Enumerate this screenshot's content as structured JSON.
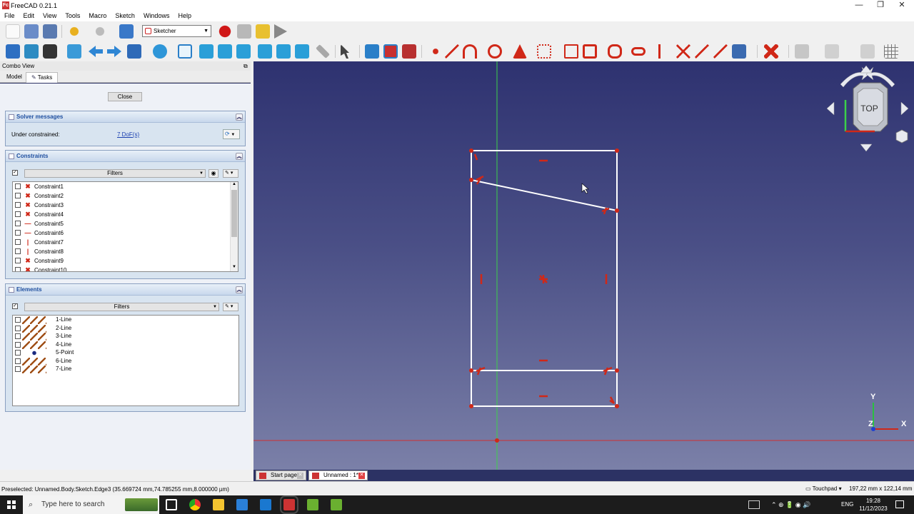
{
  "app": {
    "title": "FreeCAD 0.21.1",
    "logo_text": "Fc"
  },
  "window_controls": {
    "minimize": "—",
    "maximize": "❐",
    "close": "✕"
  },
  "menu": [
    "File",
    "Edit",
    "View",
    "Tools",
    "Macro",
    "Sketch",
    "Windows",
    "Help"
  ],
  "toolbar": {
    "workbench_label": "Sketcher"
  },
  "combo": {
    "title": "Combo View",
    "tabs": [
      "Model",
      "Tasks"
    ],
    "close_label": "Close",
    "solver": {
      "title": "Solver messages",
      "label": "Under constrained:",
      "dof_link": "7 DoF(s)"
    },
    "constraints": {
      "title": "Constraints",
      "filters_label": "Filters",
      "items": [
        {
          "label": "Constraint1",
          "icon": "coincident-icon",
          "glyph": "✖"
        },
        {
          "label": "Constraint2",
          "icon": "coincident-icon",
          "glyph": "✖"
        },
        {
          "label": "Constraint3",
          "icon": "coincident-icon",
          "glyph": "✖"
        },
        {
          "label": "Constraint4",
          "icon": "coincident-icon",
          "glyph": "✖"
        },
        {
          "label": "Constraint5",
          "icon": "horizontal-icon",
          "glyph": "—"
        },
        {
          "label": "Constraint6",
          "icon": "horizontal-icon",
          "glyph": "—"
        },
        {
          "label": "Constraint7",
          "icon": "vertical-icon",
          "glyph": "|"
        },
        {
          "label": "Constraint8",
          "icon": "vertical-icon",
          "glyph": "|"
        },
        {
          "label": "Constraint9",
          "icon": "coincident-icon",
          "glyph": "✖"
        },
        {
          "label": "Constraint10",
          "icon": "coincident-icon",
          "glyph": "✖"
        }
      ]
    },
    "elements": {
      "title": "Elements",
      "filters_label": "Filters",
      "items": [
        {
          "label": "1-Line",
          "type": "line"
        },
        {
          "label": "2-Line",
          "type": "line"
        },
        {
          "label": "3-Line",
          "type": "line"
        },
        {
          "label": "4-Line",
          "type": "line"
        },
        {
          "label": "5-Point",
          "type": "point"
        },
        {
          "label": "6-Line",
          "type": "line"
        },
        {
          "label": "7-Line",
          "type": "line"
        }
      ]
    }
  },
  "navcube": {
    "face_label": "TOP"
  },
  "axes": {
    "x_label": "X",
    "y_label": "Y",
    "z_label": "Z"
  },
  "doc_tabs": [
    {
      "label": "Start page",
      "close": "✕"
    },
    {
      "label": "Unnamed : 1*",
      "close": "✕"
    }
  ],
  "status": {
    "message": "Preselected: Unnamed.Body.Sketch.Edge3 (35.669724 mm,74.785255 mm,8.000000 µm)",
    "nav_style": "Touchpad",
    "dimensions": "197,22 mm x 122,14 mm"
  },
  "taskbar": {
    "search_placeholder": "Type here to search",
    "language": "ENG",
    "time": "19:28",
    "date": "11/12/2023",
    "tray_icons": "⌃ ⊕ 🔋 ◉ 🔊"
  },
  "colors": {
    "accent": "#2050a0",
    "constraint_red": "#d02818",
    "sketch_white": "#ffffff",
    "viewport_top": "#2e3270",
    "viewport_bottom": "#7b80a8"
  }
}
